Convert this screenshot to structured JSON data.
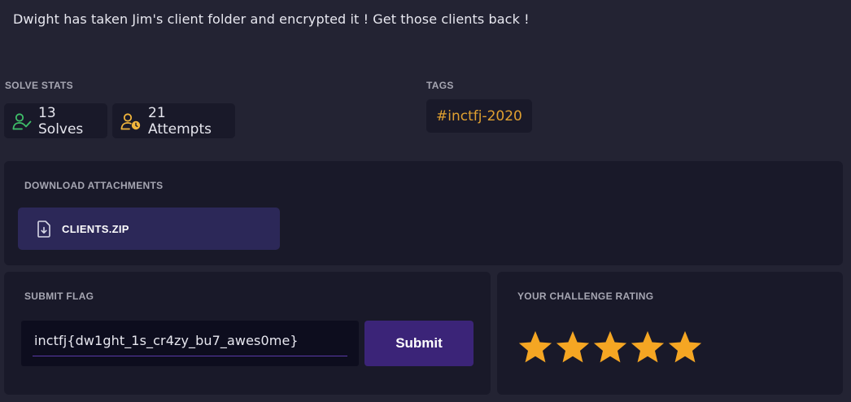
{
  "description": "Dwight has taken Jim's client folder and encrypted it ! Get those clients back !",
  "solve_stats": {
    "label": "SOLVE STATS",
    "solves_text": "13 Solves",
    "attempts_text": "21 Attempts",
    "solves_icon": "user-check-icon",
    "attempts_icon": "user-clock-icon",
    "solves_color": "#3fbf6a",
    "attempts_color": "#f0b43c"
  },
  "tags": {
    "label": "TAGS",
    "items": [
      "#inctfj-2020"
    ],
    "color": "#e0a030"
  },
  "attachments": {
    "label": "DOWNLOAD ATTACHMENTS",
    "files": [
      {
        "name": "CLIENTS.ZIP",
        "icon": "file-download-icon"
      }
    ]
  },
  "submit_flag": {
    "label": "SUBMIT FLAG",
    "value": "inctfj{dw1ght_1s_cr4zy_bu7_awes0me}",
    "button_label": "Submit"
  },
  "rating": {
    "label": "YOUR CHALLENGE RATING",
    "value": 5,
    "max": 5,
    "star_color": "#f5a623"
  }
}
